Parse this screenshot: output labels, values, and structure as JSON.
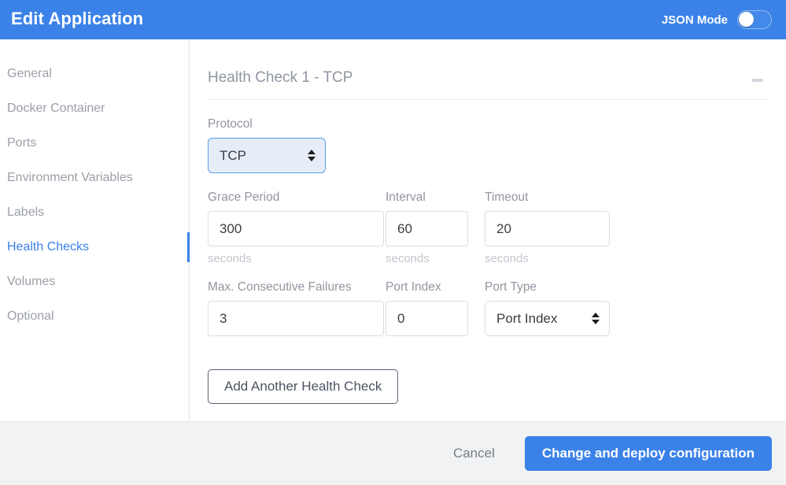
{
  "header": {
    "title": "Edit Application",
    "json_mode_label": "JSON Mode",
    "json_mode_on": false,
    "accent_color": "#3b82e8"
  },
  "sidebar": {
    "items": [
      {
        "label": "General",
        "active": false
      },
      {
        "label": "Docker Container",
        "active": false
      },
      {
        "label": "Ports",
        "active": false
      },
      {
        "label": "Environment Variables",
        "active": false
      },
      {
        "label": "Labels",
        "active": false
      },
      {
        "label": "Health Checks",
        "active": true
      },
      {
        "label": "Volumes",
        "active": false
      },
      {
        "label": "Optional",
        "active": false
      }
    ]
  },
  "main": {
    "section_title": "Health Check 1 - TCP",
    "collapse_icon": "minus-icon",
    "protocol": {
      "label": "Protocol",
      "value": "TCP"
    },
    "grace_period": {
      "label": "Grace Period",
      "value": "300",
      "helper": "seconds"
    },
    "interval": {
      "label": "Interval",
      "value": "60",
      "helper": "seconds"
    },
    "timeout": {
      "label": "Timeout",
      "value": "20",
      "helper": "seconds"
    },
    "max_failures": {
      "label": "Max. Consecutive Failures",
      "value": "3"
    },
    "port_index": {
      "label": "Port Index",
      "value": "0"
    },
    "port_type": {
      "label": "Port Type",
      "value": "Port Index"
    },
    "add_button_label": "Add Another Health Check"
  },
  "footer": {
    "cancel_label": "Cancel",
    "submit_label": "Change and deploy configuration"
  }
}
